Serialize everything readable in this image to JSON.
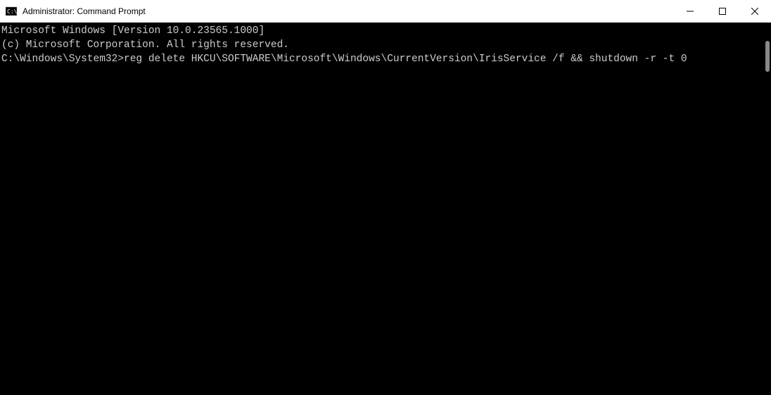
{
  "window": {
    "title": "Administrator: Command Prompt"
  },
  "terminal": {
    "line1": "Microsoft Windows [Version 10.0.23565.1000]",
    "line2": "(c) Microsoft Corporation. All rights reserved.",
    "blank": "",
    "prompt": "C:\\Windows\\System32>",
    "command": "reg delete HKCU\\SOFTWARE\\Microsoft\\Windows\\CurrentVersion\\IrisService /f && shutdown -r -t 0"
  }
}
